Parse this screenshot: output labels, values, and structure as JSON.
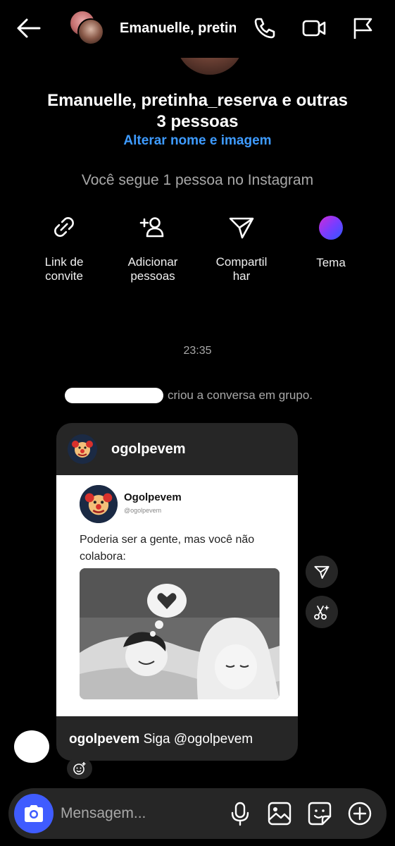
{
  "header": {
    "title": "Emanuelle, pretinha_reserva e outras 3 pessoas",
    "icons": [
      "back-arrow-icon",
      "phone-icon",
      "video-camera-icon",
      "flag-icon"
    ]
  },
  "group": {
    "name": "Emanuelle, pretinha_reserva e outras 3 pessoas",
    "edit_link": "Alterar nome e imagem",
    "follow_info": "Você segue 1 pessoa no Instagram"
  },
  "actions": [
    {
      "label": "Link de\nconvite",
      "icon": "link-icon"
    },
    {
      "label": "Adicionar\npessoas",
      "icon": "add-person-icon"
    },
    {
      "label": "Compartil\nhar",
      "icon": "send-icon"
    },
    {
      "label": "Tema",
      "icon": "theme-dot-icon"
    }
  ],
  "chat": {
    "timestamp": "23:35",
    "system_message": "criou a conversa em grupo.",
    "shared_post": {
      "username": "ogolpevem",
      "tweet_name": "Ogolpevem",
      "tweet_handle": "@ogolpevem",
      "tweet_text": "Poderia ser a gente, mas você não colabora:",
      "caption_user": "ogolpevem",
      "caption_text": " Siga @ogolpevem"
    }
  },
  "composer": {
    "placeholder": "Mensagem...",
    "icons": [
      "camera-icon",
      "microphone-icon",
      "gallery-icon",
      "sticker-icon",
      "plus-circle-icon"
    ]
  },
  "colors": {
    "background": "#000000",
    "surface": "#262626",
    "accent_link": "#3e9bff",
    "camera_button": "#3f5cff",
    "muted_text": "#a8a8a8"
  }
}
